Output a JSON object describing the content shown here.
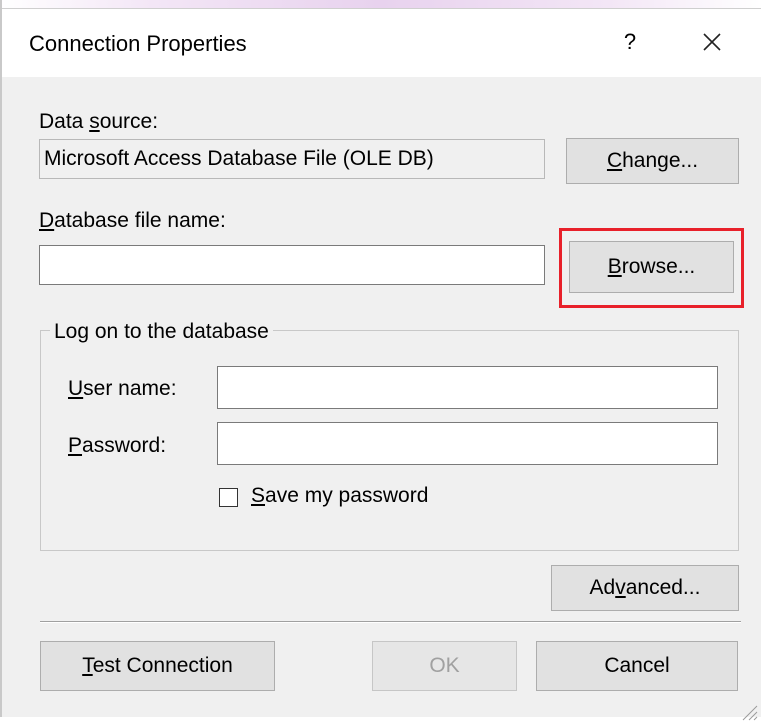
{
  "dialog": {
    "title": "Connection Properties",
    "help_label": "?"
  },
  "data_source": {
    "label_pre": "Data ",
    "label_ul": "s",
    "label_post": "ource:",
    "value": "Microsoft Access Database File (OLE DB)",
    "change_ul": "C",
    "change_post": "hange..."
  },
  "database_file": {
    "label_ul": "D",
    "label_post": "atabase file name:",
    "value": "",
    "browse_ul": "B",
    "browse_post": "rowse..."
  },
  "logon": {
    "legend": "Log on to the database",
    "username_ul": "U",
    "username_post": "ser name:",
    "username_value": "",
    "password_ul": "P",
    "password_post": "assword:",
    "password_value": "",
    "save_password_ul": "S",
    "save_password_post": "ave my password",
    "save_password_checked": false
  },
  "advanced": {
    "pre": "Ad",
    "ul": "v",
    "post": "anced..."
  },
  "footer": {
    "test_ul": "T",
    "test_post": "est Connection",
    "ok_label": "OK",
    "cancel_label": "Cancel"
  },
  "colors": {
    "highlight": "#e8202a",
    "dialog_bg": "#f0f0f0",
    "button_bg": "#e1e1e1"
  }
}
